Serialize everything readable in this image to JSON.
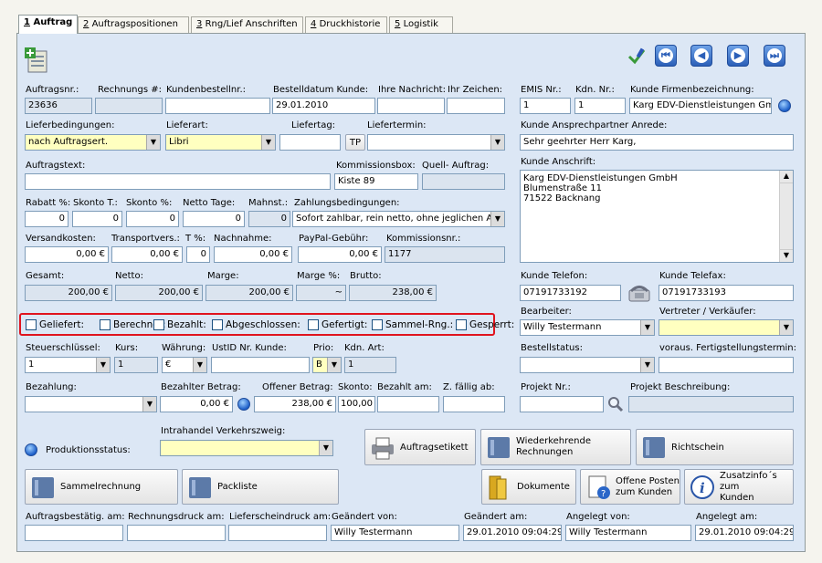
{
  "tabs": [
    {
      "num": "1",
      "label": "Auftrag"
    },
    {
      "num": "2",
      "label": "Auftragspositionen"
    },
    {
      "num": "3",
      "label": "Rng/Lief Anschriften"
    },
    {
      "num": "4",
      "label": "Druckhistorie"
    },
    {
      "num": "5",
      "label": "Logistik"
    }
  ],
  "labels": {
    "auftragsnr": "Auftragsnr.:",
    "rechnungs": "Rechnungs #:",
    "kundenbestellnr": "Kundenbestellnr.:",
    "bestelldatum": "Bestelldatum Kunde:",
    "ihre_nachricht": "Ihre Nachricht:",
    "ihr_zeichen": "Ihr Zeichen:",
    "lieferbedingungen": "Lieferbedingungen:",
    "lieferart": "Lieferart:",
    "liefertag": "Liefertag:",
    "liefertermin": "Liefertermin:",
    "tp": "TP",
    "auftragstext": "Auftragstext:",
    "kommissionsbox": "Kommissionsbox:",
    "quell_auftrag": "Quell- Auftrag:",
    "rabatt": "Rabatt %:",
    "skonto_t": "Skonto T.:",
    "skonto_p": "Skonto %:",
    "netto_tage": "Netto Tage:",
    "mahnst": "Mahnst.:",
    "zahlungsbedingungen": "Zahlungsbedingungen:",
    "versandkosten": "Versandkosten:",
    "transportvers": "Transportvers.:",
    "t_pct": "T %:",
    "nachnahme": "Nachnahme:",
    "paypal": "PayPal-Gebühr:",
    "kommissionsnr": "Kommissionsnr.:",
    "gesamt": "Gesamt:",
    "netto": "Netto:",
    "marge": "Marge:",
    "marge_pct": "Marge %:",
    "brutto": "Brutto:",
    "emis": "EMIS Nr.:",
    "kdn": "Kdn. Nr.:",
    "firmenbez": "Kunde Firmenbezeichnung:",
    "ansprechpartner": "Kunde Ansprechpartner Anrede:",
    "anschrift": "Kunde Anschrift:",
    "telefon": "Kunde Telefon:",
    "telefax": "Kunde Telefax:",
    "bearbeiter": "Bearbeiter:",
    "vertreter": "Vertreter / Verkäufer:",
    "steuerschluessel": "Steuerschlüssel:",
    "kurs": "Kurs:",
    "waehrung": "Währung:",
    "ustid": "UstID Nr. Kunde:",
    "prio": "Prio:",
    "kdn_art": "Kdn. Art:",
    "bestellstatus": "Bestellstatus:",
    "fertigstellung": "voraus. Fertigstellungstermin:",
    "bezahlung": "Bezahlung:",
    "bezahlter_betrag": "Bezahlter Betrag:",
    "offener_betrag": "Offener Betrag:",
    "skonto2": "Skonto:",
    "bezahlt_am": "Bezahlt am:",
    "z_faellig": "Z. fällig ab:",
    "projekt_nr": "Projekt Nr.:",
    "projekt_beschreibung": "Projekt Beschreibung:",
    "intrahandel": "Intrahandel Verkehrszweig:",
    "produktionsstatus": "Produktionsstatus:",
    "auftragsbestaetig": "Auftragsbestätig. am:",
    "rechnungsdruck": "Rechnungsdruck am:",
    "lieferscheindruck": "Lieferscheindruck am:",
    "geaendert_von": "Geändert von:",
    "geaendert_am": "Geändert am:",
    "angelegt_von": "Angelegt von:",
    "angelegt_am": "Angelegt am:"
  },
  "values": {
    "auftragsnr": "23636",
    "bestelldatum": "29.01.2010",
    "lieferbedingungen": "nach Auftragsert.",
    "lieferart": "Libri",
    "kommissionsbox": "Kiste 89",
    "rabatt": "0",
    "skonto_t": "0",
    "skonto_p": "0",
    "netto_tage": "0",
    "mahnst": "0",
    "zahlungsbedingungen": "Sofort zahlbar, rein netto, ohne jeglichen Abz",
    "versandkosten": "0,00 €",
    "transportvers": "0,00 €",
    "t_pct": "0",
    "nachnahme": "0,00 €",
    "paypal": "0,00 €",
    "kommissionsnr": "1177",
    "gesamt": "200,00 €",
    "netto": "200,00 €",
    "marge": "200,00 €",
    "marge_pct": "~",
    "brutto": "238,00 €",
    "emis": "1",
    "kdn": "1",
    "firmenbez": "Karg EDV-Dienstleistungen Gm",
    "ansprechpartner": "Sehr geehrter Herr Karg,",
    "anschrift": [
      "Karg EDV-Dienstleistungen GmbH",
      "Blumenstraße 11",
      "71522 Backnang"
    ],
    "telefon": "07191733192",
    "telefax": "07191733193",
    "bearbeiter": "Willy Testermann",
    "steuerschluessel": "1",
    "kurs": "1",
    "waehrung": "€",
    "prio": "B",
    "kdn_art": "1",
    "bezahlter_betrag": "0,00 €",
    "offener_betrag": "238,00 €",
    "skonto2": "100,00",
    "geaendert_von": "Willy Testermann",
    "geaendert_am": "29.01.2010 09:04:29",
    "angelegt_von": "Willy Testermann",
    "angelegt_am": "29.01.2010 09:04:29"
  },
  "checkboxes": [
    "Geliefert:",
    "Berechnet:",
    "Bezahlt:",
    "Abgeschlossen:",
    "Gefertigt:",
    "Sammel-Rng.:",
    "Gesperrt:"
  ],
  "buttons": {
    "auftragsetikett": "Auftragsetikett",
    "wiederkehrende1": "Wiederkehrende",
    "wiederkehrende2": "Rechnungen",
    "richtschein": "Richtschein",
    "sammelrechnung": "Sammelrechnung",
    "packliste": "Packliste",
    "dokumente": "Dokumente",
    "offene1": "Offene Posten",
    "offene2": "zum Kunden",
    "zusatz1": "Zusatzinfo´s zum",
    "zusatz2": "Kunden"
  },
  "colors": {
    "panel": "#dce7f5",
    "readonly": "#dbe4ef",
    "highlight": "#ffffc0",
    "checkbox_outline": "#e0141e"
  }
}
